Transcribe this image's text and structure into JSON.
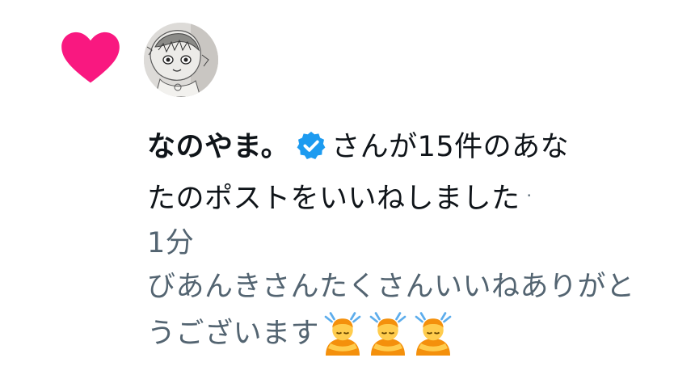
{
  "notification": {
    "user_name": "なのやま。",
    "action_line1": "さんが15件のあな",
    "action_line2": "たのポストをいいねしました",
    "separator": "·",
    "time_ago": "1分",
    "reply_text": "びあんきさんたくさんいいねありがとうございます",
    "emoji_count": 3
  },
  "icons": {
    "like": "heart-icon",
    "verified": "verified-badge-icon",
    "emoji": "bowing-person-emoji"
  },
  "colors": {
    "heart": "#f91880",
    "verified": "#1d9bf0",
    "text": "#0f1419",
    "secondary": "#536471"
  }
}
